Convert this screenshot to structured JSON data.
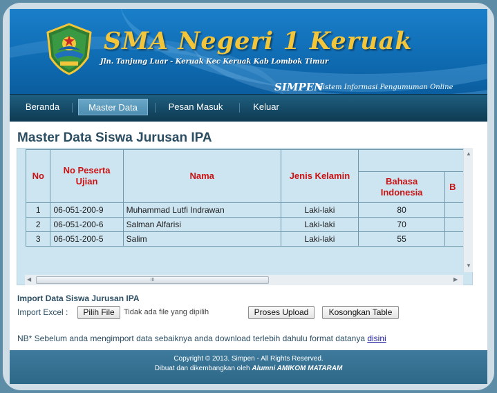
{
  "header": {
    "school_name": "SMA Negeri 1 Keruak",
    "school_address": "Jln. Tanjung Luar - Keruak Kec Keruak Kab Lombok Timur",
    "app_name": "SIMPEN",
    "app_description": "Sistem Informasi Pengumuman Online",
    "brand_color": "#1170b8",
    "title_color": "#f2c53a"
  },
  "nav": {
    "items": [
      {
        "label": "Beranda",
        "active": false
      },
      {
        "label": "Master Data",
        "active": true
      },
      {
        "label": "Pesan Masuk",
        "active": false
      },
      {
        "label": "Keluar",
        "active": false
      }
    ]
  },
  "main": {
    "title": "Master Data Siswa Jurusan IPA",
    "table": {
      "headers": {
        "no": "No",
        "nomor_peserta": "No Peserta Ujian",
        "nama": "Nama",
        "jenis_kelamin": "Jenis Kelamin",
        "bahasa_indonesia": "Bahasa Indonesia",
        "next_partial": "B"
      },
      "rows": [
        {
          "no": "1",
          "nomor_peserta": "06-051-200-9",
          "nama": "Muhammad Lutfi Indrawan",
          "jenis_kelamin": "Laki-laki",
          "bahasa_indonesia": "80"
        },
        {
          "no": "2",
          "nomor_peserta": "06-051-200-6",
          "nama": "Salman Alfarisi",
          "jenis_kelamin": "Laki-laki",
          "bahasa_indonesia": "70"
        },
        {
          "no": "3",
          "nomor_peserta": "06-051-200-5",
          "nama": "Salim",
          "jenis_kelamin": "Laki-laki",
          "bahasa_indonesia": "55"
        }
      ],
      "header_color": "#cc1111",
      "background_color": "#cde4f1"
    },
    "scrollbar": {
      "thumb_grip": "III"
    }
  },
  "import": {
    "title": "Import Data Siswa Jurusan IPA",
    "label": "Import Excel :",
    "file_button": "Pilih File",
    "file_status": "Tidak ada file yang dipilih",
    "upload_button": "Proses Upload",
    "clear_button": "Kosongkan Table"
  },
  "note": {
    "text": "NB* Sebelum anda mengimport data sebaiknya anda download terlebih dahulu format datanya",
    "link": "disini"
  },
  "footer": {
    "copyright": "Copyright © 2013. Simpen - All Rights Reserved.",
    "credit_prefix": "Dibuat dan dikembangkan oleh",
    "credit_name": "Alumni AMIKOM MATARAM"
  }
}
